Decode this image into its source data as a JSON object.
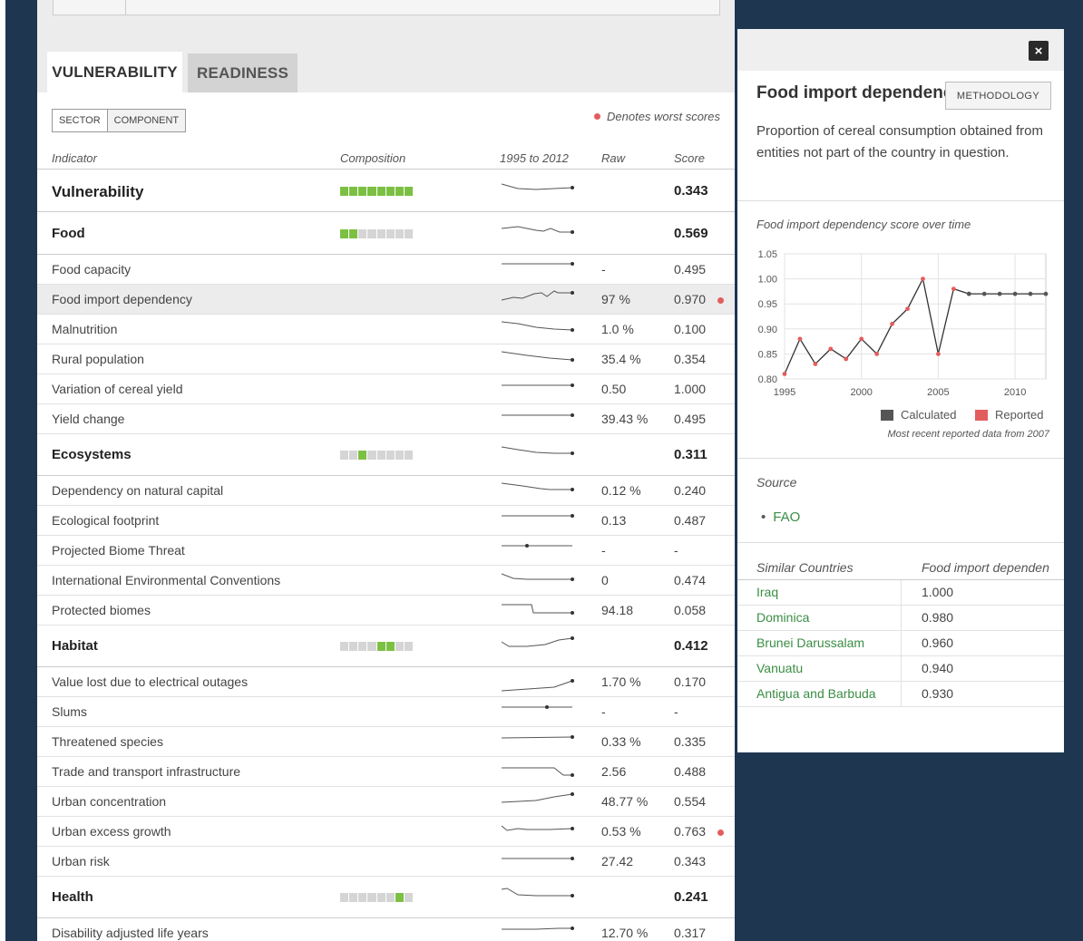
{
  "tabs": {
    "vulnerability": "VULNERABILITY",
    "readiness": "READINESS"
  },
  "toggle": {
    "sector": "SECTOR",
    "component": "COMPONENT"
  },
  "legend_worst": "Denotes worst scores",
  "columns": {
    "indicator": "Indicator",
    "composition": "Composition",
    "years": "1995 to 2012",
    "raw": "Raw",
    "score": "Score"
  },
  "rows": [
    {
      "name": "Vulnerability",
      "raw": "",
      "score": "0.343",
      "type": "top",
      "comp": [
        1,
        1,
        1,
        1,
        1,
        1,
        1,
        1
      ]
    },
    {
      "name": "Food",
      "raw": "",
      "score": "0.569",
      "type": "sector",
      "comp": [
        1,
        1,
        0,
        0,
        0,
        0,
        0,
        0
      ]
    },
    {
      "name": "Food capacity",
      "raw": "-",
      "score": "0.495",
      "type": "ind"
    },
    {
      "name": "Food import dependency",
      "raw": "97 %",
      "score": "0.970",
      "type": "ind",
      "selected": true,
      "worst": true
    },
    {
      "name": "Malnutrition",
      "raw": "1.0 %",
      "score": "0.100",
      "type": "ind"
    },
    {
      "name": "Rural population",
      "raw": "35.4 %",
      "score": "0.354",
      "type": "ind"
    },
    {
      "name": "Variation of cereal yield",
      "raw": "0.50",
      "score": "1.000",
      "type": "ind"
    },
    {
      "name": "Yield change",
      "raw": "39.43 %",
      "score": "0.495",
      "type": "ind"
    },
    {
      "name": "Ecosystems",
      "raw": "",
      "score": "0.311",
      "type": "sector",
      "comp": [
        0,
        0,
        1,
        0,
        0,
        0,
        0,
        0
      ]
    },
    {
      "name": "Dependency on natural capital",
      "raw": "0.12 %",
      "score": "0.240",
      "type": "ind"
    },
    {
      "name": "Ecological footprint",
      "raw": "0.13",
      "score": "0.487",
      "type": "ind"
    },
    {
      "name": "Projected Biome Threat",
      "raw": "-",
      "score": "-",
      "type": "ind"
    },
    {
      "name": "International Environmental Conventions",
      "raw": "0",
      "score": "0.474",
      "type": "ind"
    },
    {
      "name": "Protected biomes",
      "raw": "94.18",
      "score": "0.058",
      "type": "ind"
    },
    {
      "name": "Habitat",
      "raw": "",
      "score": "0.412",
      "type": "sector",
      "comp": [
        0,
        0,
        0,
        0,
        1,
        1,
        0,
        0
      ]
    },
    {
      "name": "Value lost due to electrical outages",
      "raw": "1.70 %",
      "score": "0.170",
      "type": "ind"
    },
    {
      "name": "Slums",
      "raw": "-",
      "score": "-",
      "type": "ind"
    },
    {
      "name": "Threatened species",
      "raw": "0.33 %",
      "score": "0.335",
      "type": "ind"
    },
    {
      "name": "Trade and transport infrastructure",
      "raw": "2.56",
      "score": "0.488",
      "type": "ind"
    },
    {
      "name": "Urban concentration",
      "raw": "48.77 %",
      "score": "0.554",
      "type": "ind"
    },
    {
      "name": "Urban excess growth",
      "raw": "0.53 %",
      "score": "0.763",
      "type": "ind",
      "worst": true
    },
    {
      "name": "Urban risk",
      "raw": "27.42",
      "score": "0.343",
      "type": "ind"
    },
    {
      "name": "Health",
      "raw": "",
      "score": "0.241",
      "type": "sector",
      "comp": [
        0,
        0,
        0,
        0,
        0,
        0,
        1,
        0
      ]
    },
    {
      "name": "Disability adjusted life years",
      "raw": "12.70 %",
      "score": "0.317",
      "type": "ind"
    }
  ],
  "panel": {
    "close_label": "×",
    "title": "Food import dependency",
    "methodology": "METHODOLOGY",
    "description": "Proportion of cereal consumption obtained from entities not part of the country in question.",
    "chart_title": "Food import dependency score over time",
    "legend_calculated": "Calculated",
    "legend_reported": "Reported",
    "recent_note": "Most recent reported data from 2007",
    "source_label": "Source",
    "source_item": "FAO",
    "similar_header": "Similar Countries",
    "value_header": "Food import dependen",
    "similar": [
      {
        "country": "Iraq",
        "value": "1.000"
      },
      {
        "country": "Dominica",
        "value": "0.980"
      },
      {
        "country": "Brunei Darussalam",
        "value": "0.960"
      },
      {
        "country": "Vanuatu",
        "value": "0.940"
      },
      {
        "country": "Antigua and Barbuda",
        "value": "0.930"
      }
    ]
  },
  "colors": {
    "navy": "#1e3650",
    "green": "#7bc043",
    "red": "#e35d5d",
    "link": "#3a8d44"
  },
  "chart_data": {
    "type": "line",
    "title": "Food import dependency score over time",
    "x_ticks": [
      "1995",
      "2000",
      "2005",
      "2010"
    ],
    "y_ticks": [
      "0.80",
      "0.85",
      "0.90",
      "0.95",
      "1.00",
      "1.05"
    ],
    "ylim": [
      0.8,
      1.05
    ],
    "xlim": [
      1995,
      2012
    ],
    "series": [
      {
        "name": "Reported",
        "color": "#e35d5d",
        "x": [
          1995,
          1996,
          1997,
          1998,
          1999,
          2000,
          2001,
          2002,
          2003,
          2004,
          2005,
          2006,
          2007
        ],
        "y": [
          0.81,
          0.88,
          0.83,
          0.86,
          0.84,
          0.88,
          0.85,
          0.91,
          0.94,
          1.0,
          0.85,
          0.98,
          0.97
        ]
      },
      {
        "name": "Calculated",
        "color": "#555555",
        "x": [
          2007,
          2008,
          2009,
          2010,
          2011,
          2012
        ],
        "y": [
          0.97,
          0.97,
          0.97,
          0.97,
          0.97,
          0.97
        ]
      }
    ],
    "legend": [
      "Calculated",
      "Reported"
    ],
    "grid": true
  }
}
